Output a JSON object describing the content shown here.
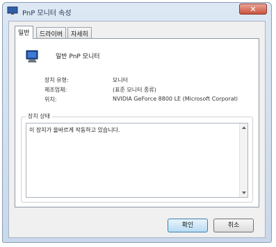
{
  "window": {
    "title": "PnP 모니터 속성",
    "close_glyph": "✕"
  },
  "tabs": [
    {
      "label": "일반",
      "active": true
    },
    {
      "label": "드라이버",
      "active": false
    },
    {
      "label": "자세히",
      "active": false
    }
  ],
  "device": {
    "icon": "monitor-icon",
    "name": "일반 PnP 모니터"
  },
  "properties": [
    {
      "label": "장치 유형:",
      "value": "모니터"
    },
    {
      "label": "제조업체:",
      "value": "(표준 모니터 종류)"
    },
    {
      "label": "위치:",
      "value": "NVIDIA GeForce 8800 LE (Microsoft Corporati"
    }
  ],
  "status": {
    "group_label": "장치 상태",
    "text": "이 장치가 올바르게 작동하고 있습니다."
  },
  "buttons": {
    "ok": "확인",
    "cancel": "취소"
  },
  "colors": {
    "accent": "#3c7fb1",
    "close": "#c9543e"
  }
}
